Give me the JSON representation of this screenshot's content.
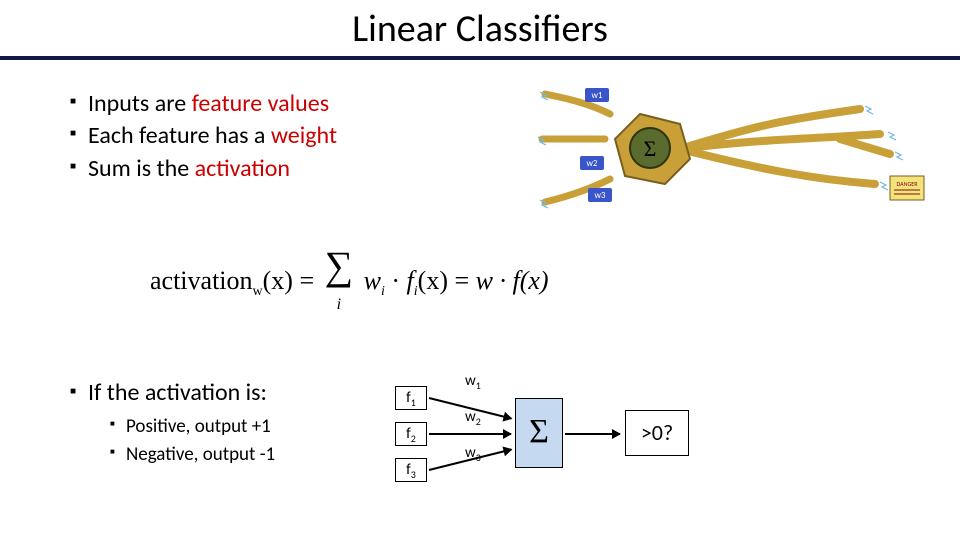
{
  "title": "Linear Classifiers",
  "bullets_top": [
    {
      "pre": "Inputs are ",
      "hl": "feature values",
      "post": ""
    },
    {
      "pre": "Each feature has a ",
      "hl": "weight",
      "post": ""
    },
    {
      "pre": "Sum is the ",
      "hl": "activation",
      "post": ""
    }
  ],
  "formula": {
    "lhs_fn": "activation",
    "lhs_sub": "w",
    "lhs_arg": "(x) = ",
    "sigma_idx": "i",
    "term1_a": "w",
    "term1_ai": "i",
    "term1_dot": " · ",
    "term1_b": "f",
    "term1_bi": "i",
    "term1_barg": "(x) = ",
    "rhs": "w · f(x)"
  },
  "bullets_bot": {
    "head": "If the activation is:",
    "sub": [
      "Positive, output +1",
      "Negative, output -1"
    ]
  },
  "diagram": {
    "f": [
      "f",
      "f",
      "f"
    ],
    "fi": [
      "1",
      "2",
      "3"
    ],
    "w": [
      "w",
      "w",
      "w"
    ],
    "wi": [
      "1",
      "2",
      "3"
    ],
    "sigma": "Σ",
    "out": ">0?"
  },
  "neuron": {
    "inputs": [
      "w1",
      "w2",
      "w3"
    ],
    "sigma": "Σ",
    "desc": "stylized neuron illustration with dendrite inputs, summation cell body, and branching axon output",
    "warn": "DANGER"
  }
}
